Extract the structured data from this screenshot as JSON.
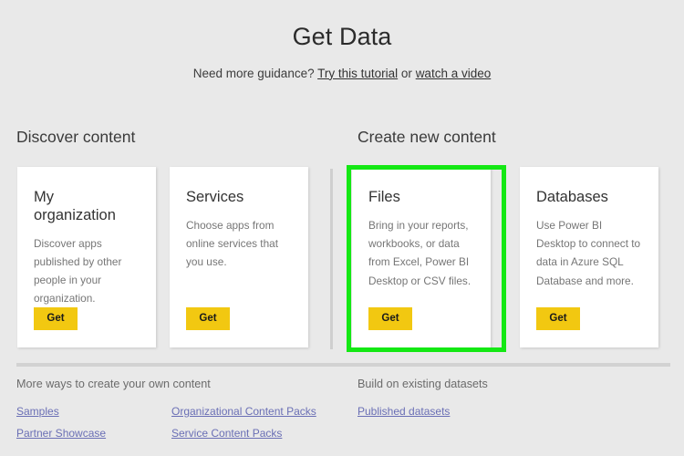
{
  "header": {
    "title": "Get Data",
    "subtitle_prefix": "Need more guidance?",
    "link_tutorial": "Try this tutorial",
    "subtitle_middle": "or",
    "link_video": "watch a video"
  },
  "sections": {
    "left_heading": "Discover content",
    "right_heading": "Create new content"
  },
  "cards": [
    {
      "title": "My organization",
      "description": "Discover apps published by other people in your organization.",
      "button_label": "Get",
      "highlighted": false
    },
    {
      "title": "Services",
      "description": "Choose apps from online services that you use.",
      "button_label": "Get",
      "highlighted": false
    },
    {
      "title": "Files",
      "description": "Bring in your reports, workbooks, or data from Excel, Power BI Desktop or CSV files.",
      "button_label": "Get",
      "highlighted": true
    },
    {
      "title": "Databases",
      "description": "Use Power BI Desktop to connect to data in Azure SQL Database and more.",
      "button_label": "Get",
      "highlighted": false
    }
  ],
  "footer": {
    "left_heading": "More ways to create your own content",
    "right_heading": "Build on existing datasets",
    "links": {
      "samples": "Samples",
      "partner_showcase": "Partner Showcase",
      "organizational_content_packs": "Organizational Content Packs",
      "service_content_packs": "Service Content Packs",
      "published_datasets": "Published datasets"
    }
  },
  "colors": {
    "background": "#e9e9e9",
    "card_background": "#ffffff",
    "accent_button": "#f2c811",
    "link": "#6a6fb5",
    "highlight_border": "#14e814",
    "divider": "#d2d2d2"
  }
}
